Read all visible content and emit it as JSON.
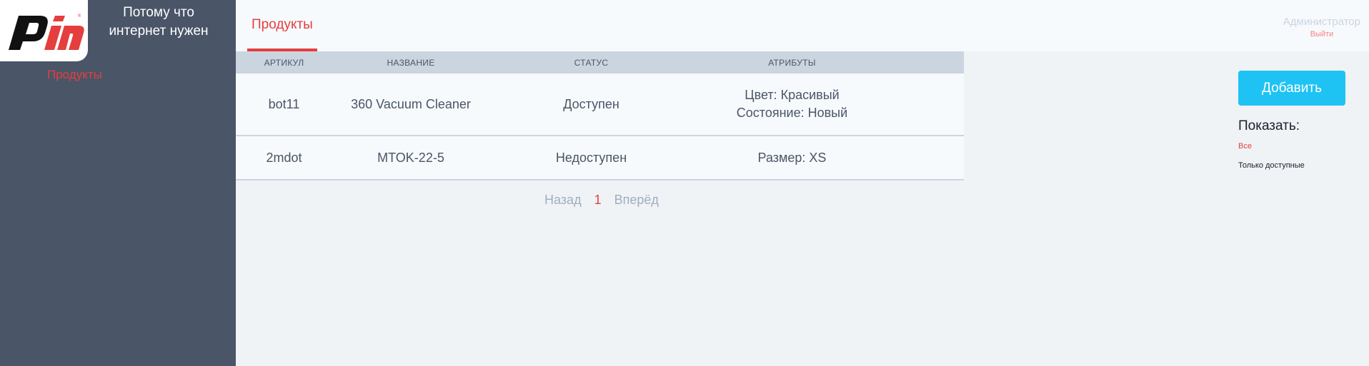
{
  "brand": {
    "logo_text": "Pin",
    "tagline": "Потому что интернет нужен"
  },
  "sidebar": {
    "items": [
      {
        "label": "Продукты"
      }
    ]
  },
  "header": {
    "tabs": [
      {
        "label": "Продукты"
      }
    ],
    "user": {
      "name": "Администратор",
      "logout": "Выйти"
    }
  },
  "table": {
    "columns": [
      "АРТИКУЛ",
      "НАЗВАНИЕ",
      "СТАТУС",
      "АТРИБУТЫ"
    ],
    "rows": [
      {
        "sku": "bot11",
        "name": "360 Vacuum Cleaner",
        "status": "Доступен",
        "attributes": [
          "Цвет: Красивый",
          "Состояние: Новый"
        ]
      },
      {
        "sku": "2mdot",
        "name": "MTOK-22-5",
        "status": "Недоступен",
        "attributes": [
          "Размер: XS"
        ]
      }
    ]
  },
  "pagination": {
    "prev": "Назад",
    "current": "1",
    "next": "Вперёд"
  },
  "actions": {
    "add_label": "Добавить"
  },
  "filters": {
    "title": "Показать:",
    "options": [
      {
        "label": "Все",
        "active": true
      },
      {
        "label": "Только доступные",
        "active": false
      }
    ]
  },
  "colors": {
    "accent": "#e53e3e",
    "sidebar_bg": "#4a5568",
    "button": "#1ec3f4"
  }
}
